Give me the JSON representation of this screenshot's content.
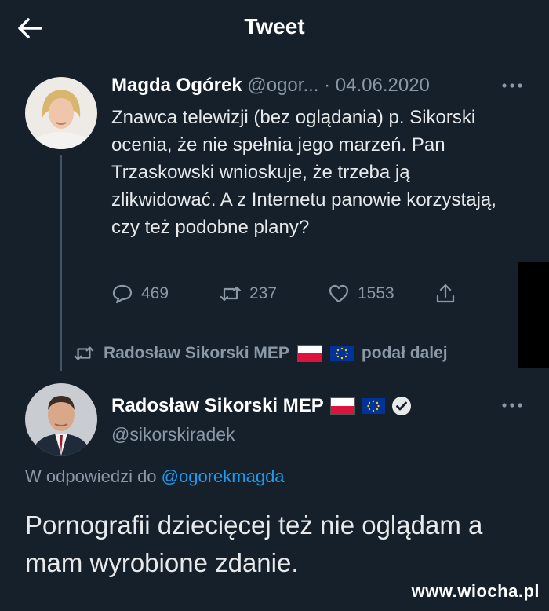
{
  "header": {
    "title": "Tweet",
    "back_icon": "back-arrow-icon"
  },
  "tweet1": {
    "author_name": "Magda Ogórek",
    "handle": "@ogor...",
    "date": "· 04.06.2020",
    "text": "Znawca telewizji (bez oglądania) p. Sikorski ocenia, że nie spełnia jego marzeń. Pan Trzaskowski wnioskuje, że trzeba ją zlikwidować. A z Internetu panowie korzystają, czy też podobne plany?",
    "actions": {
      "replies": "469",
      "retweets": "237",
      "likes": "1553"
    }
  },
  "retweet_notice": {
    "name": "Radosław Sikorski MEP",
    "suffix": "podał dalej"
  },
  "tweet2": {
    "author_name": "Radosław Sikorski MEP",
    "handle": "@sikorskiradek",
    "reply_prefix": "W odpowiedzi do",
    "reply_handle": "@ogorekmagda",
    "text": "Pornografii dziecięcej też nie oglądam a mam wyrobione zdanie."
  },
  "watermark": "www.wiocha.pl",
  "colors": {
    "background": "#15202b",
    "text": "#e7e9ea",
    "muted": "#8b98a5",
    "link": "#1d9bf0"
  }
}
